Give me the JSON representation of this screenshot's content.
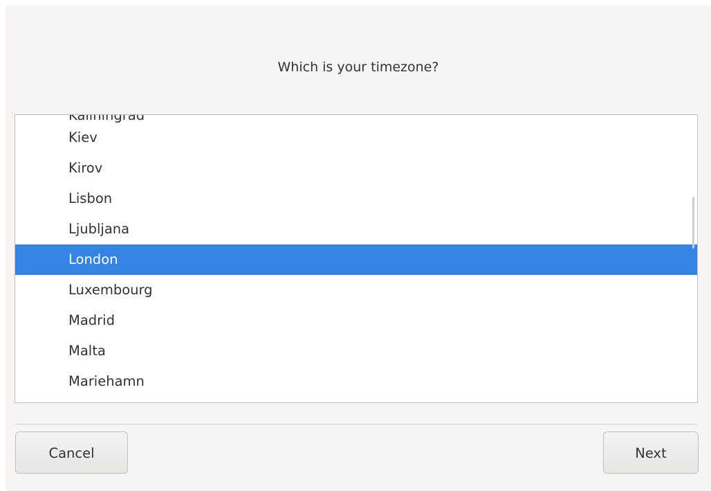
{
  "dialog": {
    "title": "Which is your timezone?"
  },
  "timezone_list": {
    "partial_item": "Kaliningrad",
    "items": [
      {
        "label": "Kiev",
        "selected": false
      },
      {
        "label": "Kirov",
        "selected": false
      },
      {
        "label": "Lisbon",
        "selected": false
      },
      {
        "label": "Ljubljana",
        "selected": false
      },
      {
        "label": "London",
        "selected": true
      },
      {
        "label": "Luxembourg",
        "selected": false
      },
      {
        "label": "Madrid",
        "selected": false
      },
      {
        "label": "Malta",
        "selected": false
      },
      {
        "label": "Mariehamn",
        "selected": false
      }
    ]
  },
  "buttons": {
    "cancel_label": "Cancel",
    "next_label": "Next"
  },
  "colors": {
    "selection": "#3584e4",
    "window_background": "#f6f5f4"
  }
}
